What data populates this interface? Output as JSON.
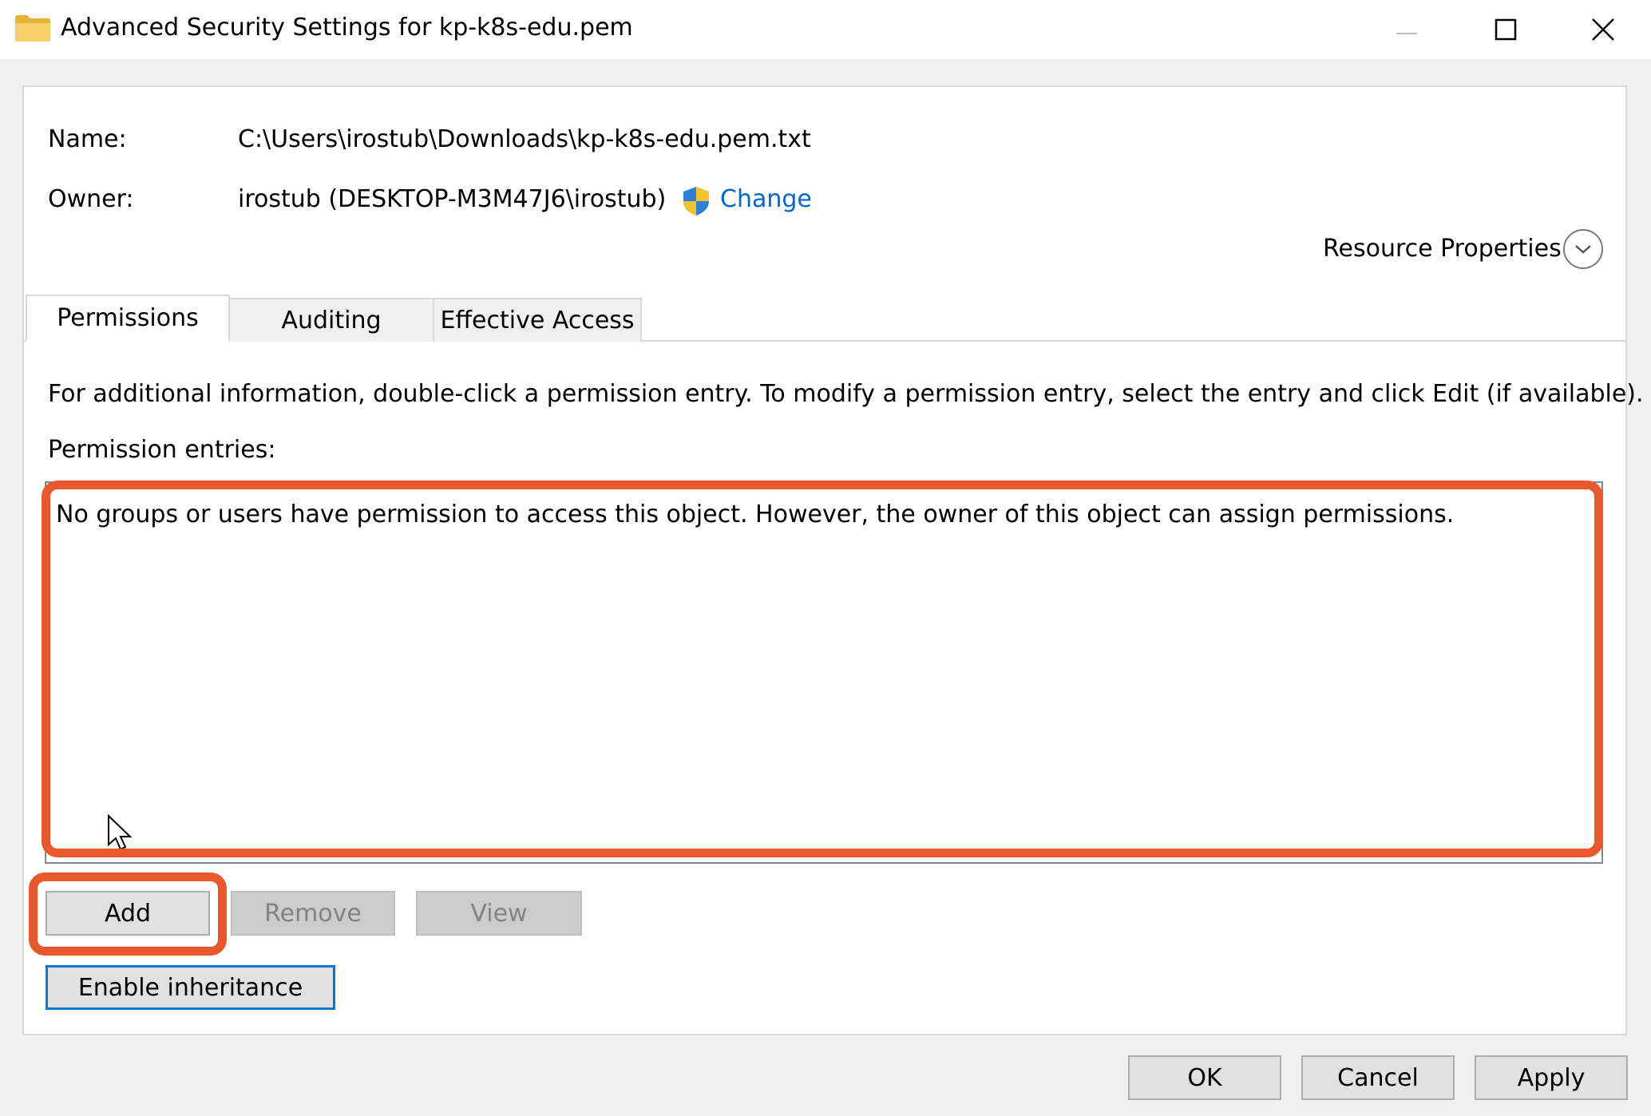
{
  "window": {
    "title": "Advanced Security Settings for kp-k8s-edu.pem",
    "controls": {
      "minimize": "minimize-icon",
      "maximize": "maximize-icon",
      "close": "close-icon"
    }
  },
  "details": {
    "name_label": "Name:",
    "name_value": "C:\\Users\\irostub\\Downloads\\kp-k8s-edu.pem.txt",
    "owner_label": "Owner:",
    "owner_value": "irostub (DESKTOP-M3M47J6\\irostub)",
    "change_link": "Change",
    "resource_properties": "Resource Properties"
  },
  "tabs": [
    {
      "label": "Permissions",
      "active": true
    },
    {
      "label": "Auditing",
      "active": false
    },
    {
      "label": "Effective Access",
      "active": false
    }
  ],
  "permissions": {
    "info_text": "For additional information, double-click a permission entry. To modify a permission entry, select the entry and click Edit (if available).",
    "entries_label": "Permission entries:",
    "empty_message": "No groups or users have permission to access this object. However, the owner of this object can assign permissions.",
    "buttons": {
      "add": "Add",
      "remove": "Remove",
      "view": "View"
    },
    "enable_inheritance": "Enable inheritance"
  },
  "footer": {
    "ok": "OK",
    "cancel": "Cancel",
    "apply": "Apply"
  },
  "colors": {
    "highlight": "#e8582c",
    "link": "#0066cc",
    "focus": "#0078d7"
  }
}
